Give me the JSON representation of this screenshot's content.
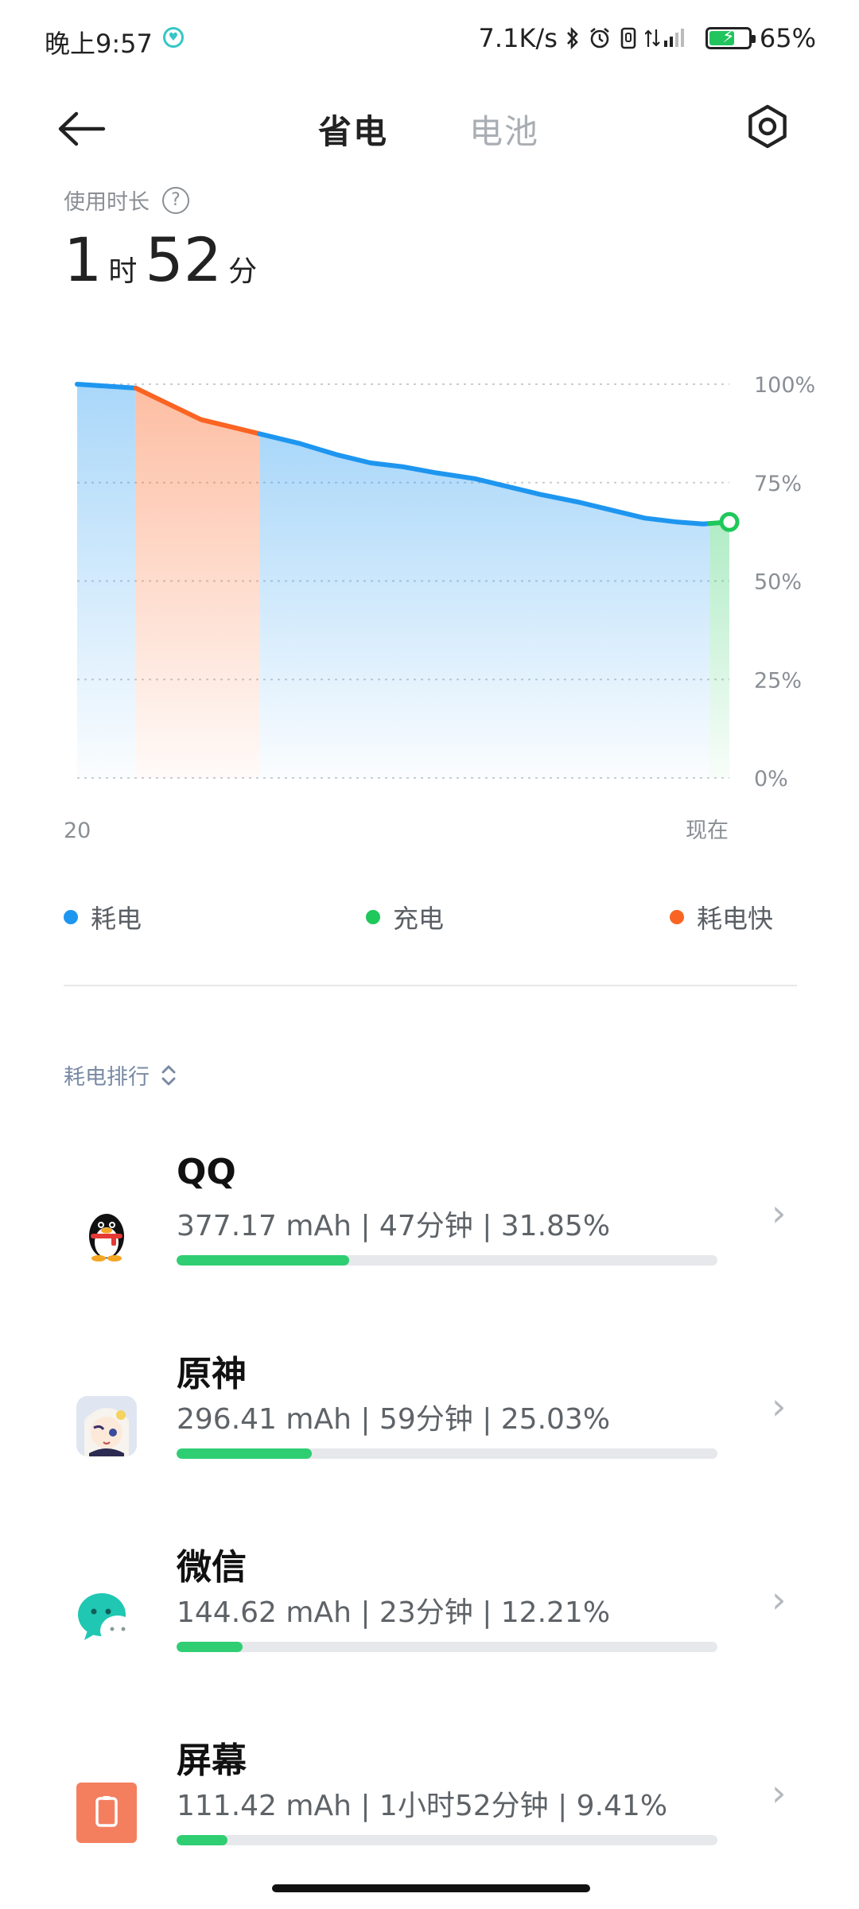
{
  "status_bar": {
    "time": "晚上9:57",
    "network_speed": "7.1K/s",
    "icons": [
      "bluetooth-icon",
      "alarm-icon",
      "nfc-icon",
      "signal-4g-icon",
      "battery-icon"
    ],
    "battery_percent": "65%",
    "battery_level": 0.65
  },
  "header": {
    "tabs": [
      {
        "label": "省电",
        "active": true
      },
      {
        "label": "电池",
        "active": false
      }
    ],
    "back_icon": "arrow-left-icon",
    "settings_icon": "gear-hex-icon"
  },
  "usage": {
    "label": "使用时长",
    "help": "?",
    "hours": "1",
    "hours_unit": "时",
    "minutes": "52",
    "minutes_unit": "分"
  },
  "chart_data": {
    "type": "area",
    "x_start_label": "20",
    "x_end_label": "现在",
    "ylim": [
      0,
      100
    ],
    "y_ticks": [
      "100%",
      "75%",
      "50%",
      "25%",
      "0%"
    ],
    "x": [
      0,
      0.09,
      0.14,
      0.19,
      0.24,
      0.29,
      0.34,
      0.4,
      0.45,
      0.5,
      0.55,
      0.61,
      0.66,
      0.71,
      0.77,
      0.82,
      0.87,
      0.92,
      0.96,
      1.0
    ],
    "y": [
      100,
      99,
      95,
      91,
      89,
      87,
      85,
      82,
      80,
      79,
      77.5,
      76,
      74,
      72,
      70,
      68,
      66,
      65,
      64.5,
      65
    ],
    "segments": [
      {
        "state": "drain",
        "from": 0,
        "to": 0.09
      },
      {
        "state": "fast_drain",
        "from": 0.09,
        "to": 0.28
      },
      {
        "state": "drain",
        "from": 0.28,
        "to": 0.97
      },
      {
        "state": "charging",
        "from": 0.97,
        "to": 1.0
      }
    ],
    "colors": {
      "drain": "#1e96f0",
      "fast_drain": "#fa6423",
      "charging": "#1ec85a"
    },
    "grid": true
  },
  "legend": [
    {
      "label": "耗电",
      "color": "#1e96f0"
    },
    {
      "label": "充电",
      "color": "#1ec85a"
    },
    {
      "label": "耗电快",
      "color": "#fa6423"
    }
  ],
  "ranking": {
    "title": "耗电排行",
    "sort_icon": "sort-updown-icon",
    "apps": [
      {
        "name": "QQ",
        "detail": "377.17 mAh | 47分钟 | 31.85%",
        "percent": 31.85,
        "icon": "qq-penguin-icon"
      },
      {
        "name": "原神",
        "detail": "296.41 mAh | 59分钟 | 25.03%",
        "percent": 25.03,
        "icon": "genshin-paimon-icon"
      },
      {
        "name": "微信",
        "detail": "144.62 mAh | 23分钟 | 12.21%",
        "percent": 12.21,
        "icon": "wechat-icon"
      },
      {
        "name": "屏幕",
        "detail": "111.42 mAh | 1小时52分钟 | 9.41%",
        "percent": 9.41,
        "icon": "screen-icon"
      }
    ]
  }
}
